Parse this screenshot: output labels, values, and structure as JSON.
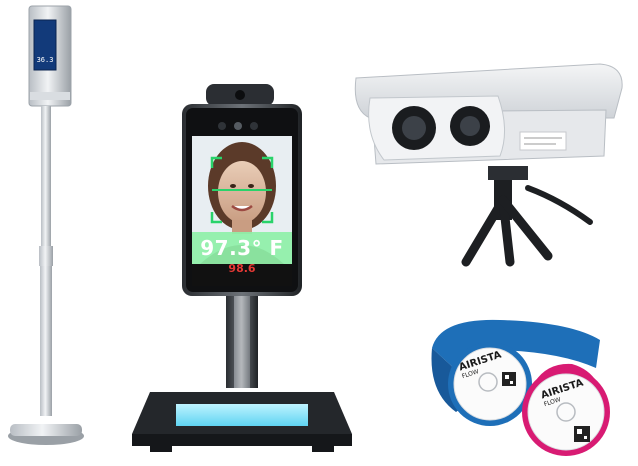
{
  "devices": {
    "pole_scanner": {
      "name": "floor-standing-thermal-scanner",
      "readout": "36.3"
    },
    "kiosk": {
      "name": "face-recognition-temperature-kiosk",
      "temperature": "97.3° F",
      "brand": "98.6"
    },
    "camera": {
      "name": "dual-lens-thermal-camera-on-tripod"
    },
    "wristbands": {
      "name": "bluetooth-temperature-wristbands",
      "brand_blue": "AIRISTA",
      "sub_blue": "FLOW",
      "brand_pink": "AIRISTA",
      "sub_pink": "FLOW"
    }
  },
  "colors": {
    "kiosk_screen_overlay": "#8ef0a8",
    "scan_frame": "#29d36a",
    "wristband_blue": "#1e6fb8",
    "wristband_pink": "#d81b73",
    "base_glow": "#7fe3ff"
  }
}
